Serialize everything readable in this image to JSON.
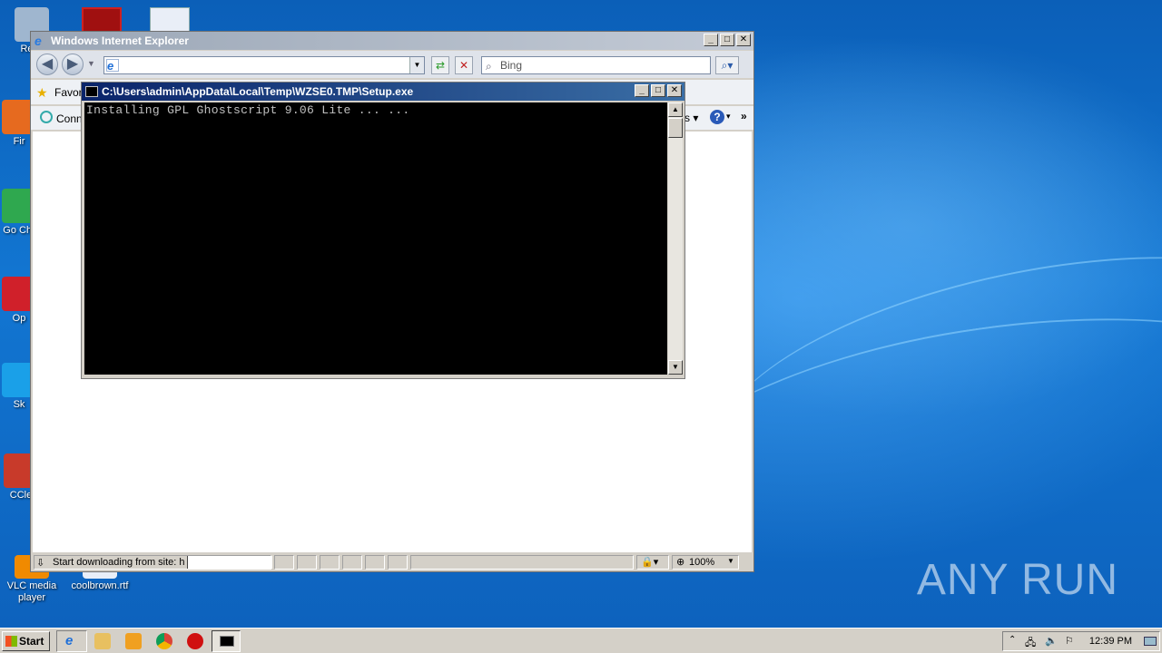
{
  "desktop": {
    "icons": [
      {
        "label": "Recy",
        "color": "#9fb6cf"
      },
      {
        "label": "Fir",
        "color": "#e66a1f"
      },
      {
        "label": "Go Chr",
        "color": "#2fa84f"
      },
      {
        "label": "Op",
        "color": "#d0202a"
      },
      {
        "label": "Sk",
        "color": "#1aa0e8"
      },
      {
        "label": "CCle",
        "color": "#c83a2a"
      },
      {
        "label": "VLC media player",
        "color": "#f08a00"
      },
      {
        "label": "coolbrown.rtf",
        "color": "#e8eef8"
      }
    ],
    "watermark": "ANY RUN"
  },
  "ie": {
    "title": "Windows Internet Explorer",
    "address_value": "",
    "search_placeholder": "Bing",
    "favorites_label": "Favor",
    "connect_label": "Conn",
    "status_text": "Start downloading from site: h",
    "zoom": "100%"
  },
  "console": {
    "title": "C:\\Users\\admin\\AppData\\Local\\Temp\\WZSE0.TMP\\Setup.exe",
    "output": "Installing GPL Ghostscript 9.06 Lite ... ..."
  },
  "taskbar": {
    "start_label": "Start",
    "clock": "12:39 PM",
    "accent": "#d4d0c8"
  }
}
